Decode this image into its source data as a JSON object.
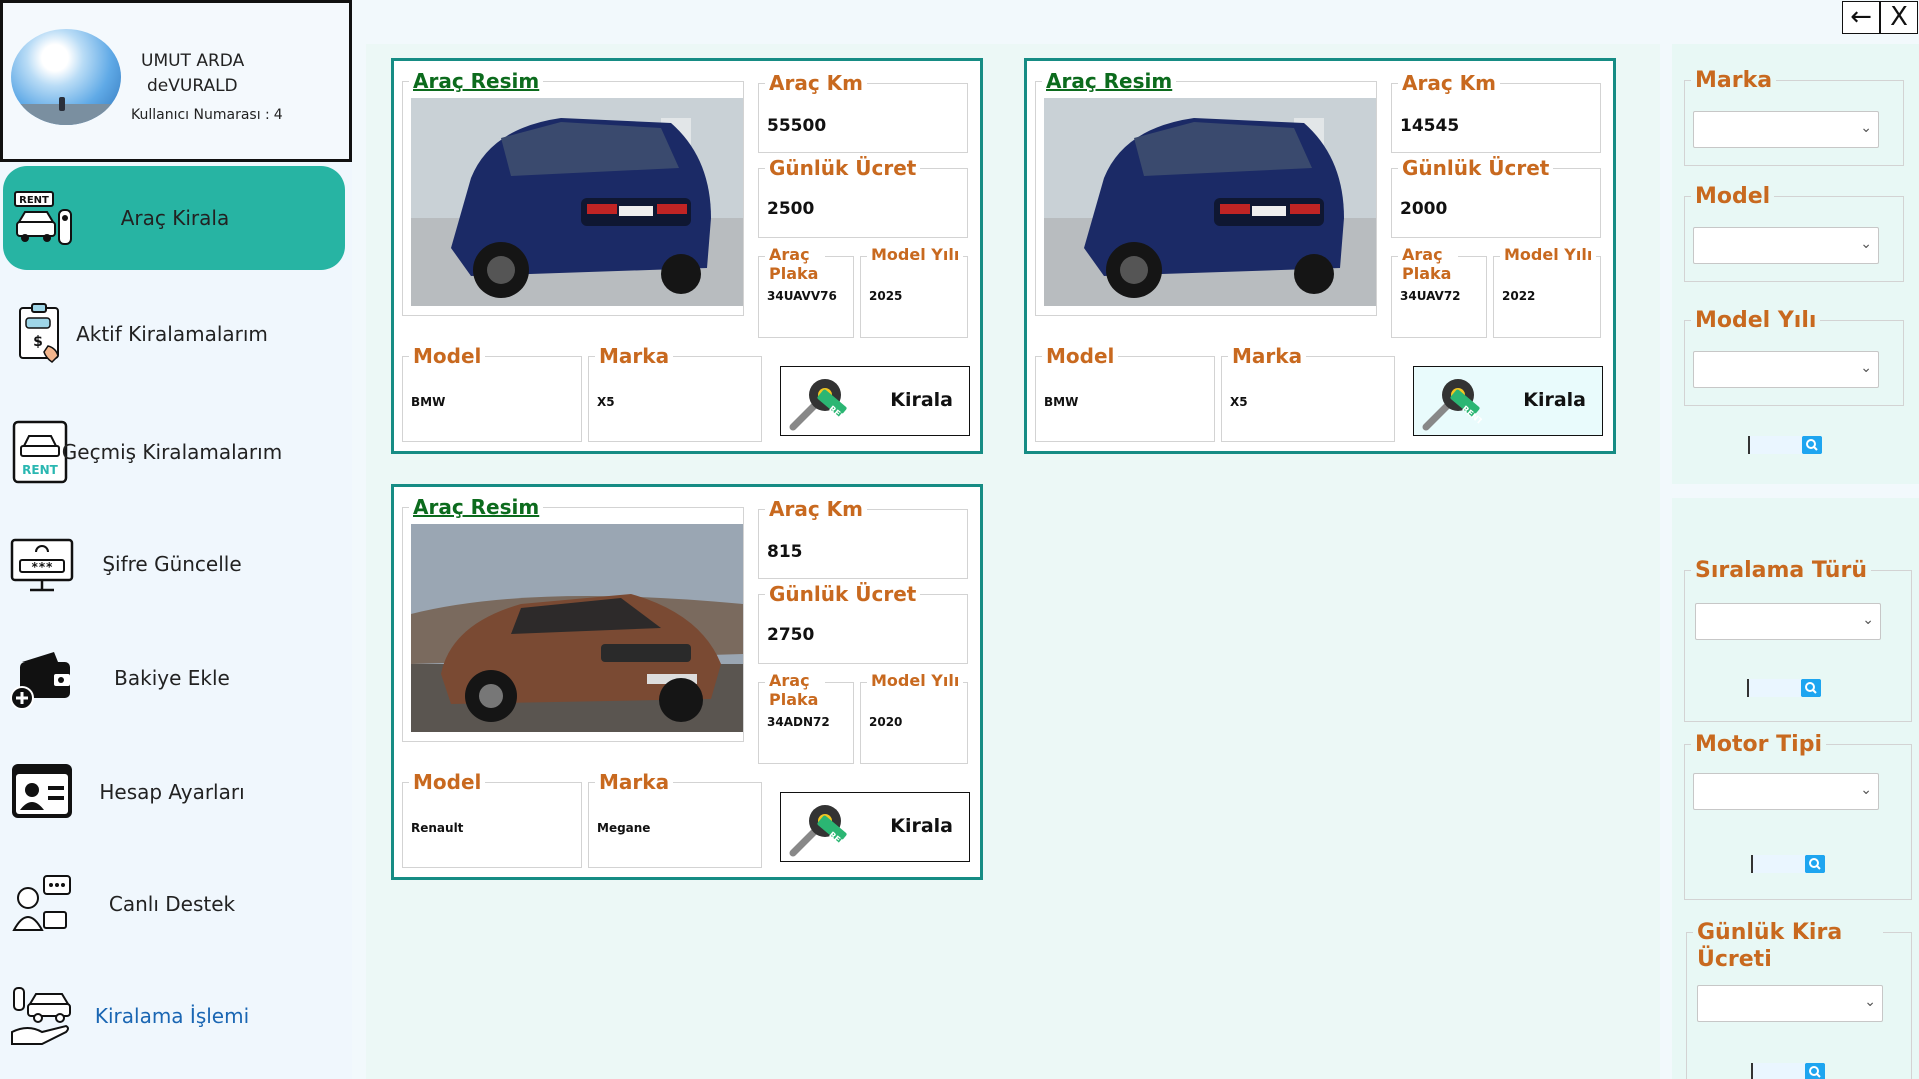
{
  "window": {
    "back_icon": "←",
    "close_label": "X"
  },
  "profile": {
    "first_line": "UMUT ARDA",
    "second_line": "deVURALD",
    "user_number_label": "Kullanıcı Numarası :",
    "user_number": "4"
  },
  "nav": [
    {
      "label": "Araç Kirala",
      "icon": "rent-car-key-icon",
      "active": true
    },
    {
      "label": "Aktif Kiralamalarım",
      "icon": "rental-document-icon"
    },
    {
      "label": "Geçmiş Kiralamalarım",
      "icon": "rent-history-icon"
    },
    {
      "label": "Şifre Güncelle",
      "icon": "password-monitor-icon"
    },
    {
      "label": "Bakiye Ekle",
      "icon": "wallet-add-icon"
    },
    {
      "label": "Hesap Ayarları",
      "icon": "account-card-icon"
    },
    {
      "label": "Canlı Destek",
      "icon": "live-support-icon"
    },
    {
      "label": "Kiralama İşlemi",
      "icon": "hand-car-icon",
      "link": true
    }
  ],
  "card_labels": {
    "image": "Araç Resim",
    "km": "Araç Km",
    "daily_fee": "Günlük Ücret",
    "plate_line1": "Araç",
    "plate_line2": "Plaka",
    "model_year": "Model Yılı",
    "model": "Model",
    "brand": "Marka",
    "rent_button": "Kirala"
  },
  "cars": [
    {
      "km": "55500",
      "daily_fee": "2500",
      "plate": "34UAVV76",
      "model_year": "2025",
      "model": "BMW",
      "brand": "X5",
      "image": "blue-bmw-x5-photo"
    },
    {
      "km": "14545",
      "daily_fee": "2000",
      "plate": "34UAV72",
      "model_year": "2022",
      "model": "BMW",
      "brand": "X5",
      "image": "blue-bmw-x5-photo"
    },
    {
      "km": "815",
      "daily_fee": "2750",
      "plate": "34ADN72",
      "model_year": "2020",
      "model": "Renault",
      "brand": "Megane",
      "image": "brown-renault-megane-photo"
    }
  ],
  "filters": {
    "brand_title": "Marka",
    "model_title": "Model",
    "model_year_title": "Model Yılı",
    "sort_title": "Sıralama Türü",
    "engine_title": "Motor Tipi",
    "daily_fee_title": "Günlük Kira Ücreti"
  },
  "colors": {
    "accent": "#27b4a3",
    "card_border": "#168c84",
    "label_orange": "#c8691f",
    "label_green": "#0c6b1d",
    "link_blue": "#1a66b3"
  }
}
